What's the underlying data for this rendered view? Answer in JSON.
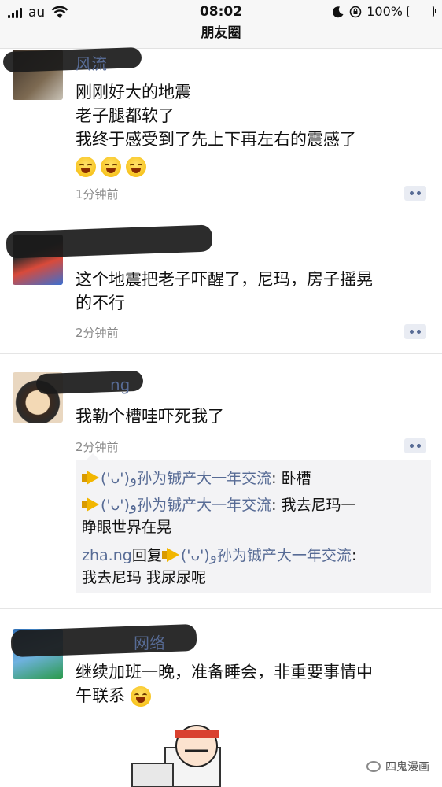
{
  "status": {
    "carrier": "au",
    "time": "08:02",
    "battery": "100%"
  },
  "nav": {
    "title": "朋友圈"
  },
  "posts": [
    {
      "author": "风流",
      "lines": [
        "刚刚好大的地震",
        "老子腿都软了",
        "我终于感受到了先上下再左右的震感了"
      ],
      "emoji": "laughing-tears-icon",
      "time": "1分钟前"
    },
    {
      "author": "",
      "lines": [
        "这个地震把老子吓醒了，尼玛，房子摇晃",
        "的不行"
      ],
      "time": "2分钟前"
    },
    {
      "author": "ng",
      "lines": [
        "我勒个槽哇吓死我了"
      ],
      "time": "2分钟前",
      "comments": [
        {
          "name": "('ᴗ')و孙为铖产大一年交流",
          "text": ": 卧槽"
        },
        {
          "name": "('ᴗ')و孙为铖产大一年交流",
          "text": ": 我去尼玛一",
          "text2": "睁眼世界在晃"
        },
        {
          "name": "zha.ng",
          "reply": "回复",
          "name2": "('ᴗ')و孙为铖产大一年交流",
          "text": ":",
          "text2": "我去尼玛 我尿尿呢"
        }
      ]
    },
    {
      "author": "网络",
      "lines": [
        "继续加班一晚，准备睡会，非重要事情中",
        "午联系"
      ],
      "emoji": "yawning-face-icon"
    }
  ],
  "watermark": "四鬼漫画"
}
